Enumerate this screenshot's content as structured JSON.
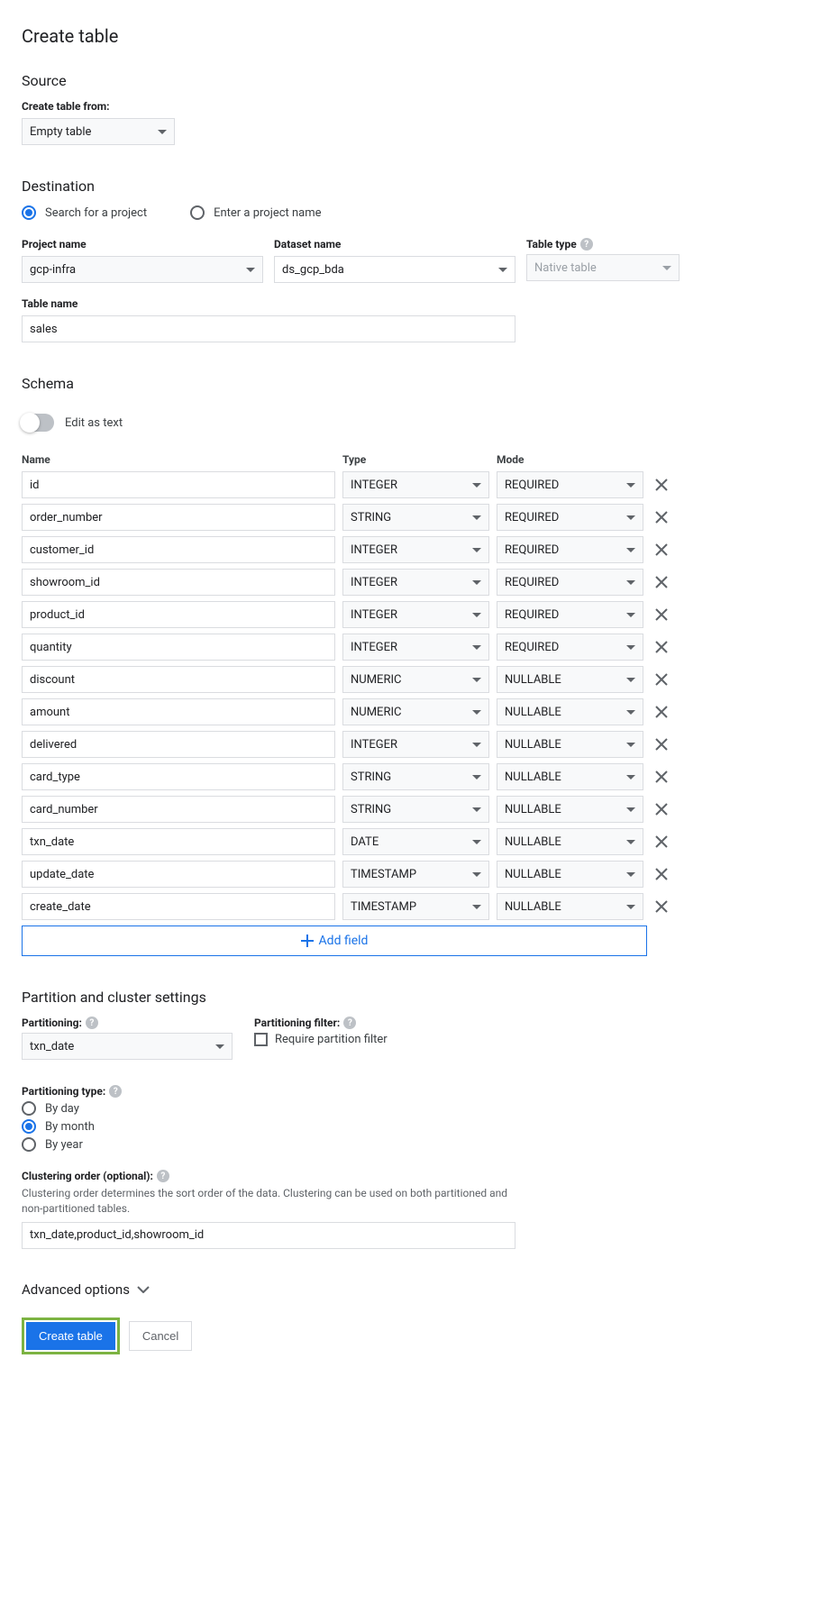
{
  "page_title": "Create table",
  "source": {
    "heading": "Source",
    "create_from_label": "Create table from:",
    "create_from_value": "Empty table"
  },
  "destination": {
    "heading": "Destination",
    "search_label": "Search for a project",
    "enter_label": "Enter a project name",
    "project_name_label": "Project name",
    "project_name_value": "gcp-infra",
    "dataset_name_label": "Dataset name",
    "dataset_name_value": "ds_gcp_bda",
    "table_type_label": "Table type",
    "table_type_value": "Native table",
    "table_name_label": "Table name",
    "table_name_value": "sales"
  },
  "schema": {
    "heading": "Schema",
    "edit_as_text_label": "Edit as text",
    "col_name": "Name",
    "col_type": "Type",
    "col_mode": "Mode",
    "add_field_label": "Add field",
    "fields": [
      {
        "name": "id",
        "type": "INTEGER",
        "mode": "REQUIRED"
      },
      {
        "name": "order_number",
        "type": "STRING",
        "mode": "REQUIRED"
      },
      {
        "name": "customer_id",
        "type": "INTEGER",
        "mode": "REQUIRED"
      },
      {
        "name": "showroom_id",
        "type": "INTEGER",
        "mode": "REQUIRED"
      },
      {
        "name": "product_id",
        "type": "INTEGER",
        "mode": "REQUIRED"
      },
      {
        "name": "quantity",
        "type": "INTEGER",
        "mode": "REQUIRED"
      },
      {
        "name": "discount",
        "type": "NUMERIC",
        "mode": "NULLABLE"
      },
      {
        "name": "amount",
        "type": "NUMERIC",
        "mode": "NULLABLE"
      },
      {
        "name": "delivered",
        "type": "INTEGER",
        "mode": "NULLABLE"
      },
      {
        "name": "card_type",
        "type": "STRING",
        "mode": "NULLABLE"
      },
      {
        "name": "card_number",
        "type": "STRING",
        "mode": "NULLABLE"
      },
      {
        "name": "txn_date",
        "type": "DATE",
        "mode": "NULLABLE"
      },
      {
        "name": "update_date",
        "type": "TIMESTAMP",
        "mode": "NULLABLE"
      },
      {
        "name": "create_date",
        "type": "TIMESTAMP",
        "mode": "NULLABLE"
      }
    ]
  },
  "partition": {
    "heading": "Partition and cluster settings",
    "partitioning_label": "Partitioning:",
    "partitioning_value": "txn_date",
    "filter_label": "Partitioning filter:",
    "require_filter_label": "Require partition filter",
    "type_label": "Partitioning type:",
    "type_options": [
      "By day",
      "By month",
      "By year"
    ],
    "type_selected": "By month",
    "clustering_label": "Clustering order (optional):",
    "clustering_hint": "Clustering order determines the sort order of the data. Clustering can be used on both partitioned and non-partitioned tables.",
    "clustering_value": "txn_date,product_id,showroom_id"
  },
  "advanced_label": "Advanced options",
  "buttons": {
    "create": "Create table",
    "cancel": "Cancel"
  }
}
